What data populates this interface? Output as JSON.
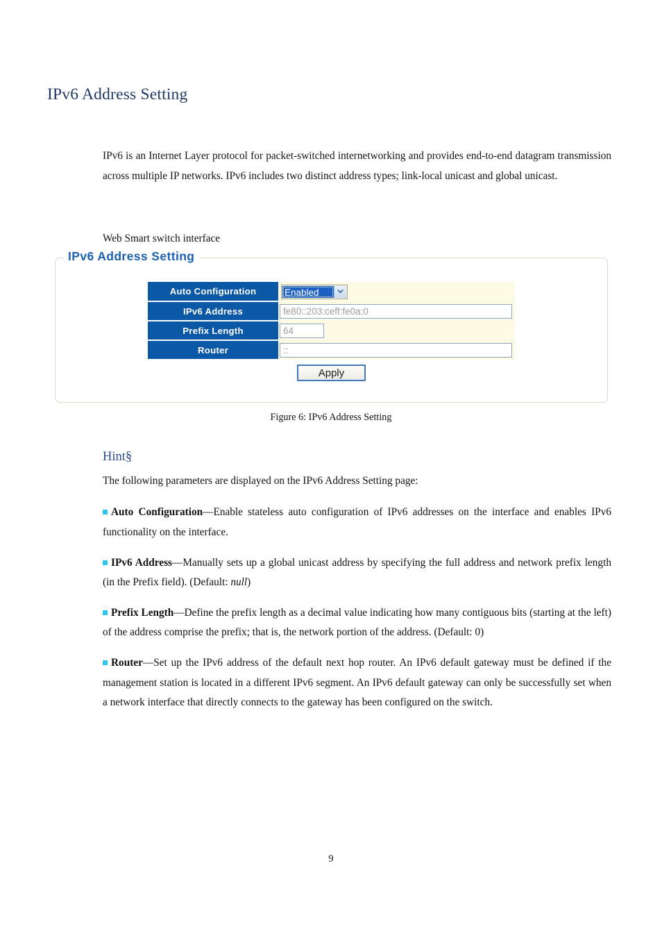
{
  "document": {
    "title": "IPv6 Address Setting",
    "intro_paragraph": "IPv6 is an Internet Layer protocol for packet-switched internetworking and provides end-to-end datagram transmission across multiple IP networks. IPv6 includes two distinct address types; link-local unicast and global unicast.",
    "pre_figure_label": "Web Smart switch interface",
    "figure_caption": "Figure 6: IPv6 Address Setting",
    "page_number": "9"
  },
  "panel": {
    "legend": "IPv6 Address Setting",
    "rows": [
      {
        "label": "Auto Configuration",
        "control": "select",
        "value": "Enabled"
      },
      {
        "label": "IPv6 Address",
        "control": "text-wide",
        "value": "fe80::203:ceff:fe0a:0"
      },
      {
        "label": "Prefix Length",
        "control": "text-narrow",
        "value": "64"
      },
      {
        "label": "Router",
        "control": "text-wide",
        "value": "::"
      }
    ],
    "apply_label": "Apply",
    "colors": {
      "label_cell": "#0a58a6",
      "row_cream": "#fdfbe4",
      "legend_text": "#1b5fae",
      "select_highlight": "#1d60c4",
      "button_border": "#4277bb"
    }
  },
  "hint": {
    "title": "Hint§",
    "lead": "The following parameters are displayed on the IPv6 Address Setting page:",
    "items": [
      {
        "term": "Auto Configuration",
        "dash": "—",
        "body": "Enable stateless auto configuration of IPv6 addresses on the interface and enables IPv6 functionality on the interface."
      },
      {
        "term": "IPv6 Address",
        "dash": "—",
        "body_before": "Manually sets up a global unicast address by specifying the full address and network prefix length (in the Prefix field). (Default: ",
        "italic": "null",
        "body_after": ")"
      },
      {
        "term": "Prefix Length",
        "dash": "—",
        "body": "Define the prefix length as a decimal value indicating how many contiguous bits (starting at the left) of the address comprise the prefix; that is, the network portion of the address. (Default: 0)"
      },
      {
        "term": "Router",
        "dash": "—",
        "body": "Set up the IPv6 address of the default next hop router. An IPv6 default gateway must be defined if the management station is located in a different IPv6 segment. An IPv6 default gateway can only be successfully set when a network interface that directly connects to the gateway has been configured on the switch."
      }
    ],
    "bullet_color": "#2ec5f0"
  }
}
